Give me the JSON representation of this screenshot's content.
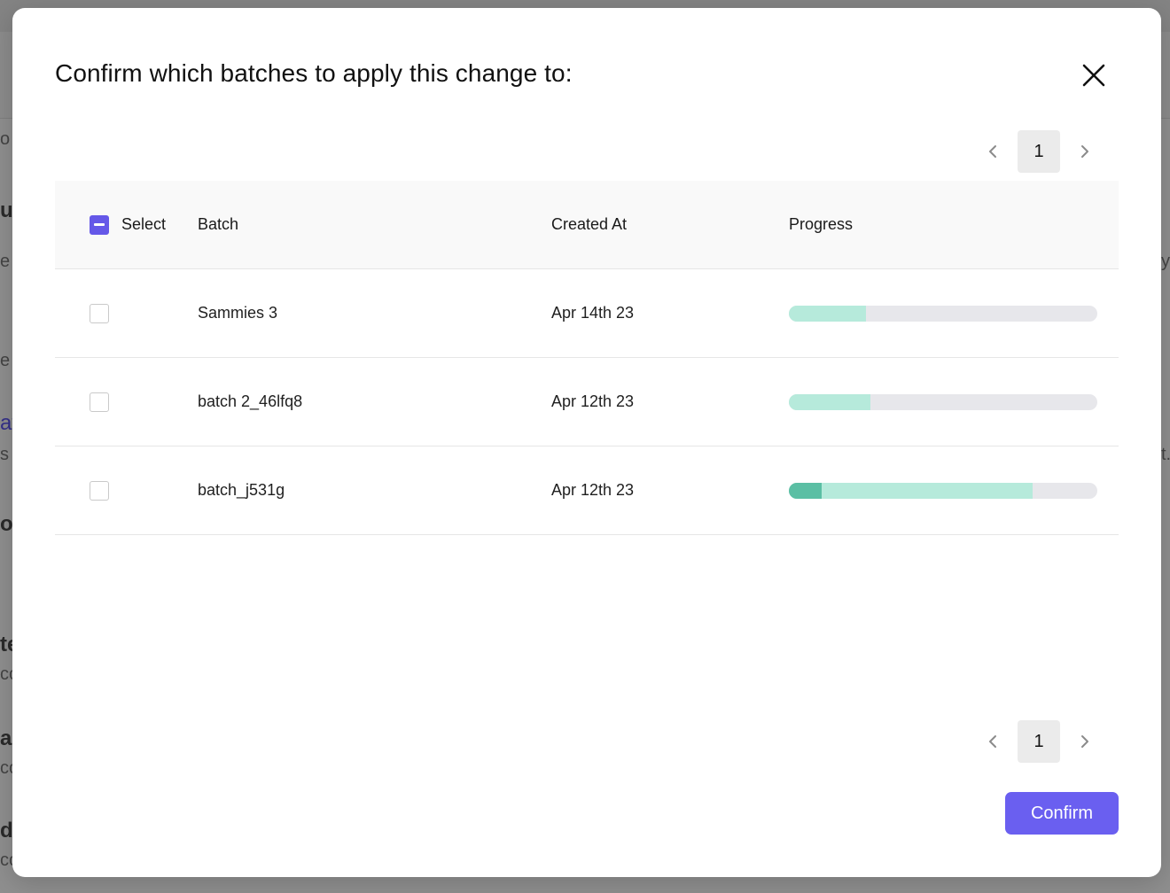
{
  "background_fragments": {
    "left": [
      "o",
      "u",
      "e",
      "e",
      "at",
      "s",
      "o",
      "te",
      "co",
      "as",
      "co",
      "d",
      "co"
    ],
    "right": [
      "y",
      "t."
    ]
  },
  "modal": {
    "title": "Confirm which batches to apply this change to:",
    "close_icon": "close-icon"
  },
  "pagination": {
    "current_page": "1",
    "prev_icon": "chevron-left-icon",
    "next_icon": "chevron-right-icon"
  },
  "table": {
    "headers": {
      "select": "Select",
      "batch": "Batch",
      "created_at": "Created At",
      "progress": "Progress"
    },
    "select_all_state": "indeterminate",
    "rows": [
      {
        "batch": "Sammies 3",
        "created_at": "Apr 14th 23",
        "checked": false,
        "progress_completed": 0.0,
        "progress_in_progress": 0.25
      },
      {
        "batch": "batch 2_46lfq8",
        "created_at": "Apr 12th 23",
        "checked": false,
        "progress_completed": 0.0,
        "progress_in_progress": 0.265
      },
      {
        "batch": "batch_j531g",
        "created_at": "Apr 12th 23",
        "checked": false,
        "progress_completed": 0.105,
        "progress_in_progress": 0.79
      }
    ]
  },
  "footer": {
    "confirm_label": "Confirm"
  },
  "colors": {
    "accent": "#6a5ff0",
    "progress_in_progress": "#b6eadb",
    "progress_completed": "#5bbfa4",
    "progress_track": "#e7e7eb"
  }
}
